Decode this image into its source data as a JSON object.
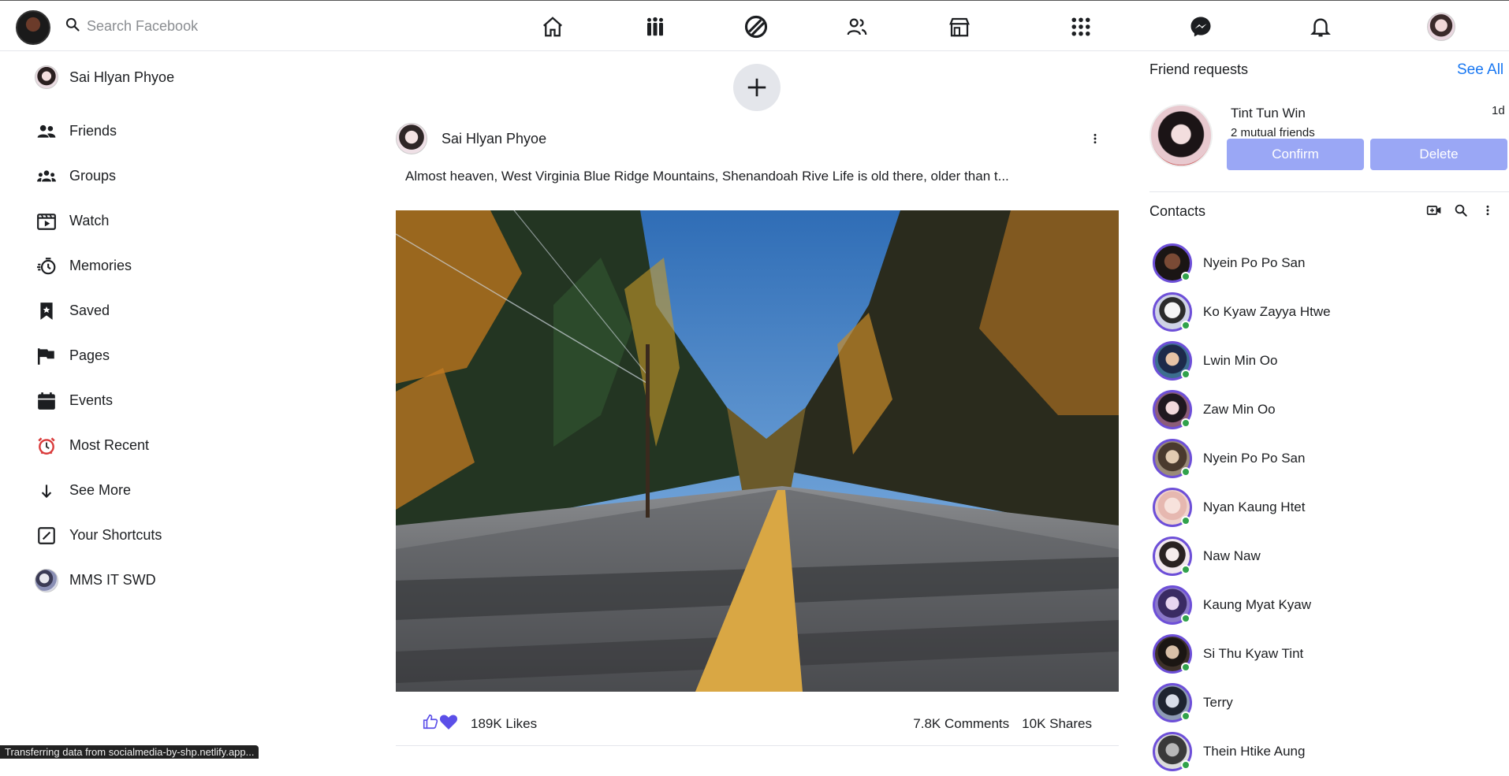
{
  "header": {
    "search_placeholder": "Search Facebook",
    "nav_icons": [
      "home-icon",
      "groups-icon",
      "watch-icon",
      "friends-icon",
      "marketplace-icon",
      "menu-grid-icon",
      "messenger-icon",
      "notifications-icon"
    ]
  },
  "sidebar": {
    "items": [
      {
        "label": "Sai Hlyan Phyoe",
        "icon": "profile-avatar"
      },
      {
        "label": "Friends",
        "icon": "friends-icon"
      },
      {
        "label": "Groups",
        "icon": "groups-icon"
      },
      {
        "label": "Watch",
        "icon": "watch-icon"
      },
      {
        "label": "Memories",
        "icon": "memories-icon"
      },
      {
        "label": "Saved",
        "icon": "saved-icon"
      },
      {
        "label": "Pages",
        "icon": "flag-icon"
      },
      {
        "label": "Events",
        "icon": "calendar-icon"
      },
      {
        "label": "Most Recent",
        "icon": "alarm-clock-icon"
      },
      {
        "label": "See More",
        "icon": "arrow-down-icon"
      },
      {
        "label": "Your Shortcuts",
        "icon": "shortcut-icon"
      },
      {
        "label": "MMS IT SWD",
        "icon": "group-avatar"
      }
    ]
  },
  "post": {
    "author": "Sai Hlyan Phyoe",
    "text": "Almost heaven, West Virginia Blue Ridge Mountains, Shenandoah Rive Life is old there, older than t...",
    "likes": "189K Likes",
    "comments": "7.8K Comments",
    "shares": "10K Shares"
  },
  "friend_requests": {
    "title": "Friend requests",
    "see_all": "See All",
    "request": {
      "name": "Tint Tun Win",
      "time": "1d",
      "mutual": "2 mutual friends",
      "confirm": "Confirm",
      "delete": "Delete"
    }
  },
  "contacts": {
    "title": "Contacts",
    "people": [
      {
        "name": "Nyein Po Po San"
      },
      {
        "name": "Ko Kyaw Zayya Htwe"
      },
      {
        "name": "Lwin Min Oo"
      },
      {
        "name": "Zaw Min Oo"
      },
      {
        "name": "Nyein Po Po San"
      },
      {
        "name": "Nyan Kaung Htet"
      },
      {
        "name": "Naw Naw"
      },
      {
        "name": "Kaung Myat Kyaw"
      },
      {
        "name": "Si Thu Kyaw Tint"
      },
      {
        "name": "Terry"
      },
      {
        "name": "Thein Htike Aung"
      }
    ]
  },
  "status_bar": "Transferring data from socialmedia-by-shp.netlify.app...",
  "colors": {
    "accent": "#1877f2",
    "button": "#9aa7f5",
    "reaction": "#5b4fe8",
    "online": "#31a24c"
  }
}
